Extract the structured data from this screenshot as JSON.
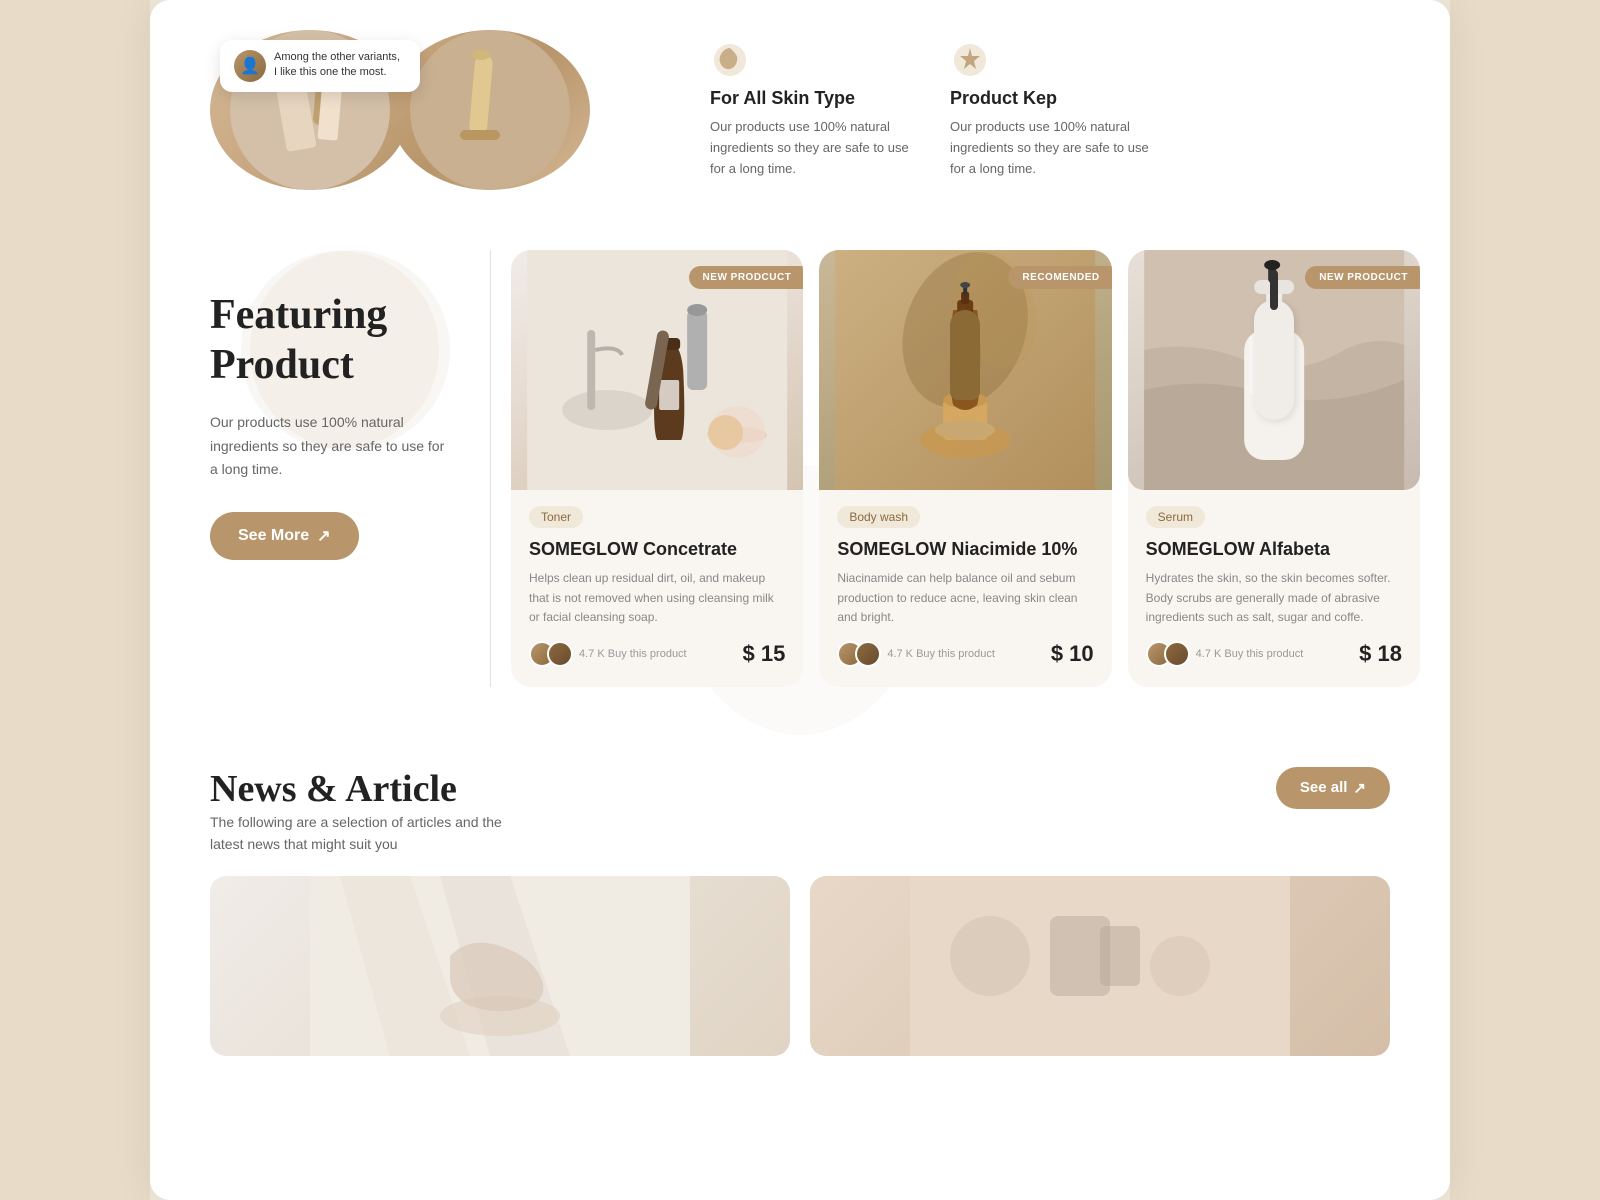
{
  "review": {
    "text": "Among the other variants, I like this one the most.",
    "avatar_alt": "reviewer avatar"
  },
  "features": [
    {
      "icon": "🌿",
      "title": "For All Skin Type",
      "desc": "Our products use 100% natural ingredients so they are safe to use for a long time."
    },
    {
      "icon": "⭐",
      "title": "Product Kep",
      "desc": "Our products use 100% natural ingredients so they are safe to use for a long time."
    }
  ],
  "featuring": {
    "title": "Featuring\nProduct",
    "desc": "Our products use 100% natural ingredients so they are safe to use for a long time.",
    "see_more_label": "See More",
    "see_more_arrow": "↗"
  },
  "products": [
    {
      "badge": "NEW PRODCUCT",
      "category": "Toner",
      "name": "SOMEGLOW Concetrate",
      "desc": "Helps clean up residual dirt, oil, and makeup that is not removed when using cleansing milk or facial cleansing soap.",
      "buyers": "4.7 K Buy this product",
      "price": "$ 15"
    },
    {
      "badge": "RECOMENDED",
      "category": "Body wash",
      "name": "SOMEGLOW Niacimide 10%",
      "desc": "Niacinamide can help balance oil and sebum production to reduce acne, leaving skin clean and bright.",
      "buyers": "4.7 K Buy this product",
      "price": "$ 10"
    },
    {
      "badge": "NEW PRODCUCT",
      "category": "Serum",
      "name": "SOMEGLOW Alfabeta",
      "desc": "Hydrates the skin, so the skin becomes softer. Body scrubs are generally made of abrasive ingredients such as salt, sugar and coffe.",
      "buyers": "4.7 K Buy this product",
      "price": "$ 18"
    }
  ],
  "news": {
    "title": "News & Article",
    "subtitle": "The following are a selection of articles and the latest news that might suit you",
    "see_all_label": "See all",
    "see_all_arrow": "↗"
  }
}
